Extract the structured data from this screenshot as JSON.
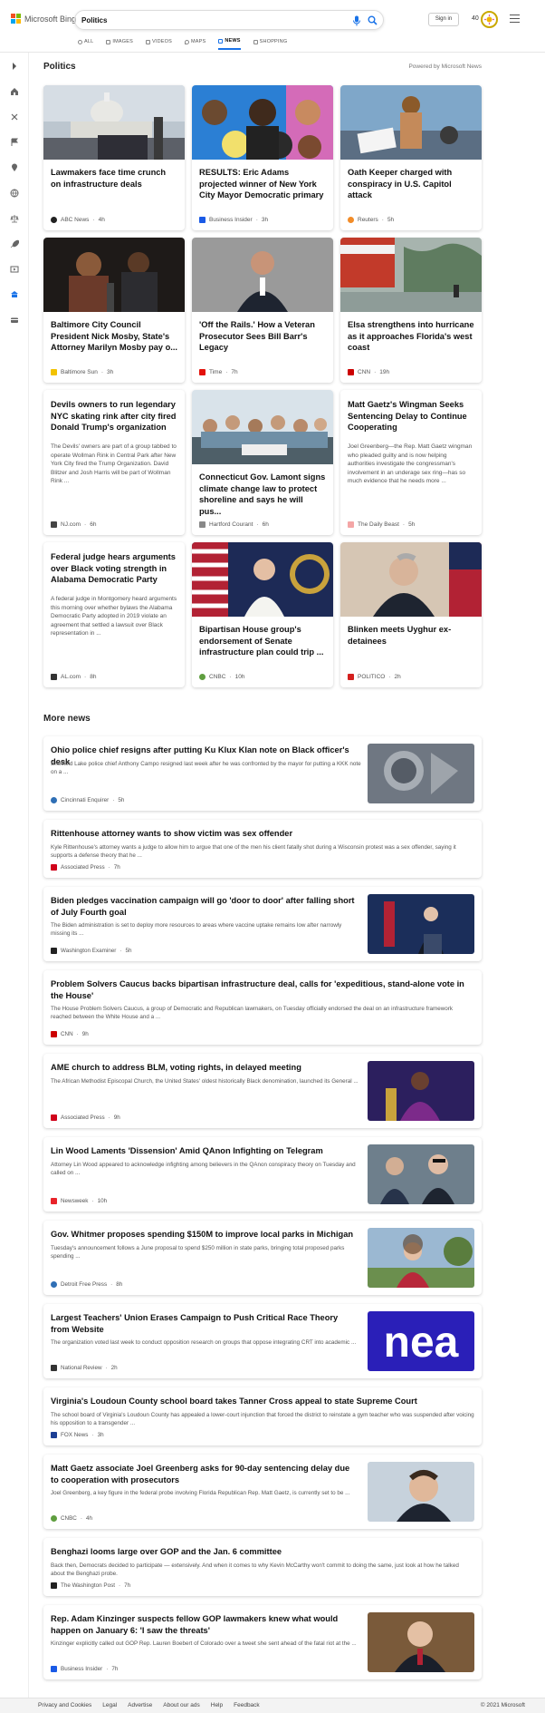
{
  "brand": {
    "name": "Microsoft Bing"
  },
  "search": {
    "value": "Politics",
    "placeholder": ""
  },
  "header": {
    "signin_label": "Sign in",
    "points": "40"
  },
  "tabs": [
    "ALL",
    "IMAGES",
    "VIDEOS",
    "MAPS",
    "NEWS",
    "SHOPPING"
  ],
  "active_tab": "NEWS",
  "politics": {
    "title": "Politics",
    "powered": "Powered by Microsoft News",
    "cards": [
      {
        "title": "Lawmakers face time crunch on infrastructure deals",
        "source": "ABC News",
        "time": "4h",
        "fav_color": "#222222"
      },
      {
        "title": "RESULTS: Eric Adams projected winner of New York City Mayor Democratic primary",
        "source": "Business Insider",
        "time": "3h",
        "fav_color": "#1a5ae6"
      },
      {
        "title": "Oath Keeper charged with conspiracy in U.S. Capitol attack",
        "source": "Reuters",
        "time": "5h",
        "fav_color": "#f28c28"
      },
      {
        "title": "Baltimore City Council President Nick Mosby, State's Attorney Marilyn Mosby pay o...",
        "source": "Baltimore Sun",
        "time": "3h",
        "fav_color": "#f2c200"
      },
      {
        "title": "'Off the Rails.' How a Veteran Prosecutor Sees Bill Barr's Legacy",
        "source": "Time",
        "time": "7h",
        "fav_color": "#e3120b"
      },
      {
        "title": "Elsa strengthens into hurricane as it approaches Florida's west coast",
        "source": "CNN",
        "time": "19h",
        "fav_color": "#cc0000"
      },
      {
        "title": "Devils owners to run legendary NYC skating rink after city fired Donald Trump's organization",
        "snippet": "The Devils' owners are part of a group tabbed to operate Wollman Rink in Central Park after New York City fired the Trump Organization. David Blitzer and Josh Harris will be part of Wollman Rink ...",
        "source": "NJ.com",
        "time": "6h",
        "fav_color": "#444444"
      },
      {
        "title": "Connecticut Gov. Lamont signs climate change law to protect shoreline and says he will pus...",
        "source": "Hartford Courant",
        "time": "6h",
        "fav_color": "#888888"
      },
      {
        "title": "Matt Gaetz's Wingman Seeks Sentencing Delay to Continue Cooperating",
        "snippet": "Joel Greenberg—the Rep. Matt Gaetz wingman who pleaded guilty and is now helping authorities investigate the congressman's involvement in an underage sex ring—has so much evidence that he needs more ...",
        "source": "The Daily Beast",
        "time": "5h",
        "fav_color": "#f4a6a6"
      },
      {
        "title": "Federal judge hears arguments over Black voting strength in Alabama Democratic Party",
        "snippet": "A federal judge in Montgomery heard arguments this morning over whether bylaws the Alabama Democratic Party adopted in 2019 violate an agreement that settled a lawsuit over Black representation in ...",
        "source": "AL.com",
        "time": "8h",
        "fav_color": "#333333"
      },
      {
        "title": "Bipartisan House group's endorsement of Senate infrastructure plan could trip ...",
        "source": "CNBC",
        "time": "10h",
        "fav_color": "#5f9e3f"
      },
      {
        "title": "Blinken meets Uyghur ex-detainees",
        "source": "POLITICO",
        "time": "2h",
        "fav_color": "#d4201e"
      }
    ]
  },
  "more_news": {
    "title": "More news",
    "items": [
      {
        "title": "Ohio police chief resigns after putting Ku Klux Klan note on Black officer's desk",
        "snippet": "Sheffield Lake police chief Anthony Campo resigned last week after he was confronted by the mayor for putting a KKK note on a ...",
        "source": "Cincinnati Enquirer",
        "time": "5h",
        "fav_color": "#2f6fb5"
      },
      {
        "title": "Rittenhouse attorney wants to show victim was sex offender",
        "snippet": "Kyle Rittenhouse's attorney wants a judge to allow him to argue that one of the men his client fatally shot during a Wisconsin protest was a sex offender, saying it supports a defense theory that he ...",
        "source": "Associated Press",
        "time": "7h",
        "fav_color": "#d0021b"
      },
      {
        "title": "Biden pledges vaccination campaign will go 'door to door' after falling short of July Fourth goal",
        "snippet": "The Biden administration is set to deploy more resources to areas where vaccine uptake remains low after narrowly missing its ...",
        "source": "Washington Examiner",
        "time": "5h",
        "fav_color": "#222222"
      },
      {
        "title": "Problem Solvers Caucus backs bipartisan infrastructure deal, calls for 'expeditious, stand-alone vote in the House'",
        "snippet": "The House Problem Solvers Caucus, a group of Democratic and Republican lawmakers, on Tuesday officially endorsed the deal on an infrastructure framework reached between the White House and a ...",
        "source": "CNN",
        "time": "9h",
        "fav_color": "#cc0000"
      },
      {
        "title": "AME church to address BLM, voting rights, in delayed meeting",
        "snippet": "The African Methodist Episcopal Church, the United States' oldest historically Black denomination, launched its General ...",
        "source": "Associated Press",
        "time": "9h",
        "fav_color": "#d0021b"
      },
      {
        "title": "Lin Wood Laments 'Dissension' Amid QAnon Infighting on Telegram",
        "snippet": "Attorney Lin Wood appeared to acknowledge infighting among believers in the QAnon conspiracy theory on Tuesday and called on ...",
        "source": "Newsweek",
        "time": "10h",
        "fav_color": "#e8232a"
      },
      {
        "title": "Gov. Whitmer proposes spending $150M to improve local parks in Michigan",
        "snippet": "Tuesday's announcement follows a June proposal to spend $250 million in state parks, bringing total proposed parks spending ...",
        "source": "Detroit Free Press",
        "time": "8h",
        "fav_color": "#2f6fb5"
      },
      {
        "title": "Largest Teachers' Union Erases Campaign to Push Critical Race Theory from Website",
        "snippet": "The organization voted last week to conduct opposition research on groups that oppose integrating CRT into academic ...",
        "source": "National Review",
        "time": "2h",
        "fav_color": "#333333"
      },
      {
        "title": "Virginia's Loudoun County school board takes Tanner Cross appeal to state Supreme Court",
        "snippet": "The school board of Virginia's Loudoun County has appealed a lower-court injunction that forced the district to reinstate a gym teacher who was suspended after voicing his opposition to a transgender ...",
        "source": "FOX News",
        "time": "3h",
        "fav_color": "#1c3f94"
      },
      {
        "title": "Matt Gaetz associate Joel Greenberg asks for 90-day sentencing delay due to cooperation with prosecutors",
        "snippet": "Joel Greenberg, a key figure in the federal probe involving Florida Republican Rep. Matt Gaetz, is currently set to be ...",
        "source": "CNBC",
        "time": "4h",
        "fav_color": "#5f9e3f"
      },
      {
        "title": "Benghazi looms large over GOP and the Jan. 6 committee",
        "snippet": "Back then, Democrats decided to participate — extensively. And when it comes to why Kevin McCarthy won't commit to doing the same, just look at how he talked about the Benghazi probe.",
        "source": "The Washington Post",
        "time": "7h",
        "fav_color": "#222222"
      },
      {
        "title": "Rep. Adam Kinzinger suspects fellow GOP lawmakers knew what would happen on January 6: 'I saw the threats'",
        "snippet": "Kinzinger explicitly called out GOP Rep. Lauren Boebert of Colorado over a tweet she sent ahead of the fatal riot at the ...",
        "source": "Business Insider",
        "time": "7h",
        "fav_color": "#1a5ae6"
      }
    ]
  },
  "footer": {
    "links": [
      "Privacy and Cookies",
      "Legal",
      "Advertise",
      "About our ads",
      "Help",
      "Feedback"
    ],
    "copyright": "© 2021 Microsoft"
  },
  "colors": {
    "accent": "#1a73e8",
    "background": "#ffffff"
  },
  "icons": [
    "search-icon",
    "mic-icon",
    "hamburger-icon",
    "rewards-icon"
  ]
}
